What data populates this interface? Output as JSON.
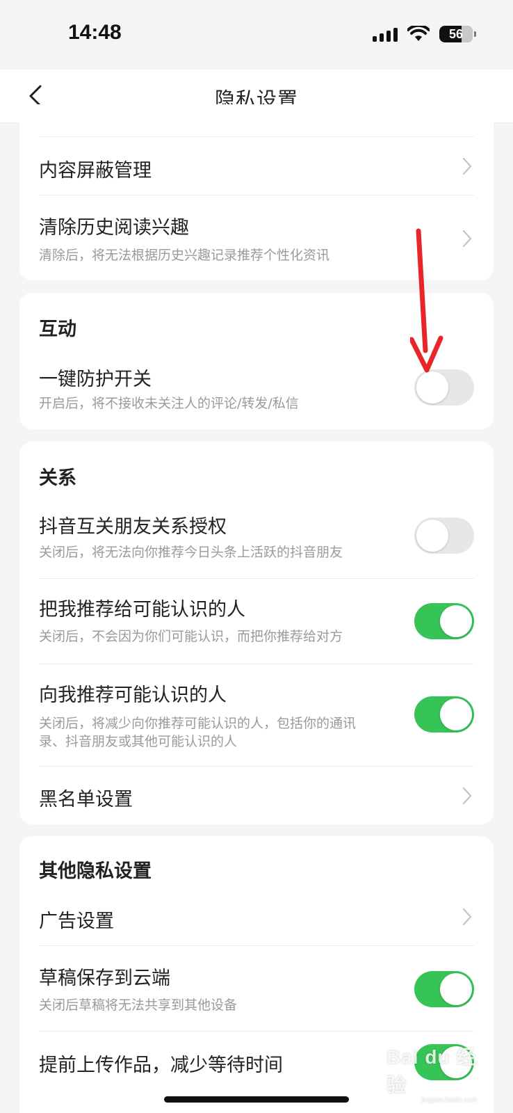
{
  "status_bar": {
    "time": "14:48",
    "battery": "56"
  },
  "nav": {
    "title": "隐私设置"
  },
  "content_section": {
    "items": [
      {
        "title": "内容屏蔽管理"
      },
      {
        "title": "清除历史阅读兴趣",
        "subtitle": "清除后，将无法根据历史兴趣记录推荐个性化资讯"
      }
    ]
  },
  "interaction_section": {
    "title": "互动",
    "items": [
      {
        "title": "一键防护开关",
        "subtitle": "开启后，将不接收未关注人的评论/转发/私信",
        "enabled": false
      }
    ]
  },
  "relation_section": {
    "title": "关系",
    "items": [
      {
        "title": "抖音互关朋友关系授权",
        "subtitle": "关闭后，将无法向你推荐今日头条上活跃的抖音朋友",
        "enabled": false
      },
      {
        "title": "把我推荐给可能认识的人",
        "subtitle": "关闭后，不会因为你们可能认识，而把你推荐给对方",
        "enabled": true
      },
      {
        "title": "向我推荐可能认识的人",
        "subtitle_line1": "关闭后，将减少向你推荐可能认识的人，包括你的通讯",
        "subtitle_line2": "录、抖音朋友或其他可能认识的人",
        "enabled": true
      },
      {
        "title": "黑名单设置"
      }
    ]
  },
  "other_section": {
    "title": "其他隐私设置",
    "items": [
      {
        "title": "广告设置"
      },
      {
        "title": "草稿保存到云端",
        "subtitle": "关闭后草稿将无法共享到其他设备",
        "enabled": true
      },
      {
        "title": "提前上传作品，减少等待时间",
        "enabled": true
      }
    ]
  },
  "watermark": {
    "text": "Bai du 经验",
    "url": "jingyan.baidu.com"
  },
  "colors": {
    "toggle_on": "#35c455",
    "toggle_off": "#e7e7e7",
    "annotation_arrow": "#e8262a"
  }
}
